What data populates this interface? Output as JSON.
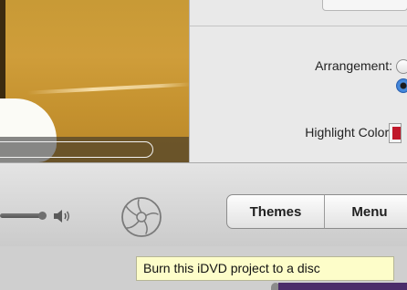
{
  "inspector": {
    "arrangement_label": "Arrangement:",
    "highlight_color_label": "Highlight Color:",
    "highlight_color": "#c0182a",
    "arrangement_selected_index": 1
  },
  "toolbar": {
    "tabs": [
      {
        "label": "Themes"
      },
      {
        "label": "Menu"
      }
    ],
    "burn_tooltip": "Burn this iDVD project to a disc"
  },
  "icons": {
    "speaker": "speaker-volume-icon",
    "burn": "burn-disc-icon"
  }
}
